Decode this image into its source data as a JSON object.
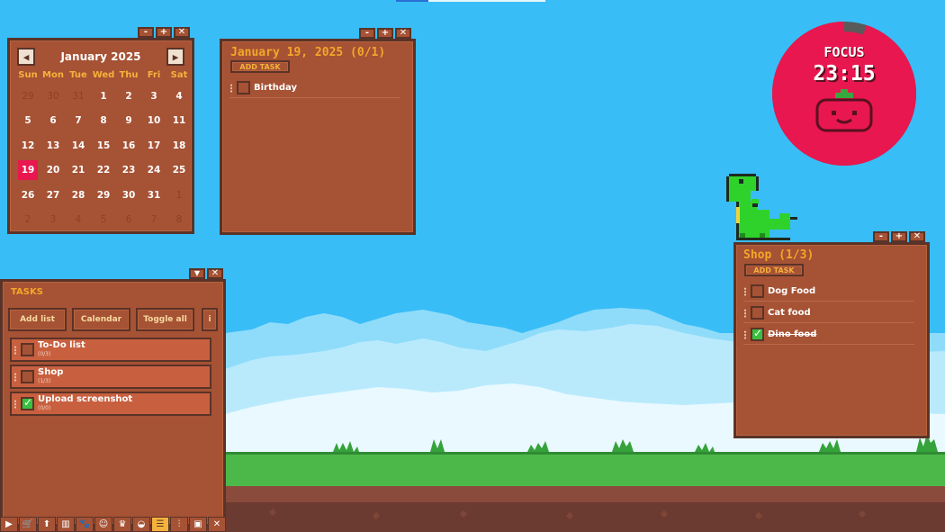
{
  "window_controls": {
    "minimize": "-",
    "maximize": "+",
    "close": "✕"
  },
  "calendar": {
    "prev_icon": "◀",
    "next_icon": "▶",
    "title": "January 2025",
    "weekdays": [
      "Sun",
      "Mon",
      "Tue",
      "Wed",
      "Thu",
      "Fri",
      "Sat"
    ],
    "days": [
      {
        "d": "29",
        "muted": true
      },
      {
        "d": "30",
        "muted": true
      },
      {
        "d": "31",
        "muted": true
      },
      {
        "d": "1"
      },
      {
        "d": "2"
      },
      {
        "d": "3"
      },
      {
        "d": "4"
      },
      {
        "d": "5"
      },
      {
        "d": "6"
      },
      {
        "d": "7"
      },
      {
        "d": "8"
      },
      {
        "d": "9"
      },
      {
        "d": "10"
      },
      {
        "d": "11"
      },
      {
        "d": "12"
      },
      {
        "d": "13"
      },
      {
        "d": "14"
      },
      {
        "d": "15"
      },
      {
        "d": "16"
      },
      {
        "d": "17"
      },
      {
        "d": "18"
      },
      {
        "d": "19",
        "today": true
      },
      {
        "d": "20"
      },
      {
        "d": "21"
      },
      {
        "d": "22"
      },
      {
        "d": "23"
      },
      {
        "d": "24"
      },
      {
        "d": "25"
      },
      {
        "d": "26"
      },
      {
        "d": "27"
      },
      {
        "d": "28"
      },
      {
        "d": "29"
      },
      {
        "d": "30"
      },
      {
        "d": "31"
      },
      {
        "d": "1",
        "muted": true
      },
      {
        "d": "2",
        "muted": true
      },
      {
        "d": "3",
        "muted": true
      },
      {
        "d": "4",
        "muted": true
      },
      {
        "d": "5",
        "muted": true
      },
      {
        "d": "6",
        "muted": true
      },
      {
        "d": "7",
        "muted": true
      },
      {
        "d": "8",
        "muted": true
      }
    ],
    "today_color": "#e8174f"
  },
  "dayview": {
    "title": "January 19, 2025 (0/1)",
    "add_task": "ADD TASK",
    "tasks": [
      {
        "label": "Birthday",
        "done": false
      }
    ]
  },
  "pomodoro": {
    "label": "FOCUS",
    "time": "23:15",
    "progress": 0.05,
    "color": "#e8174f"
  },
  "shop": {
    "title": "Shop (1/3)",
    "add_task": "ADD TASK",
    "tasks": [
      {
        "label": "Dog Food",
        "done": false
      },
      {
        "label": "Cat food",
        "done": false
      },
      {
        "label": "Dino food",
        "done": true
      }
    ]
  },
  "tasks_panel": {
    "title": "TASKS",
    "dropdown_icon": "▼",
    "close": "✕",
    "buttons": {
      "add_list": "Add list",
      "calendar": "Calendar",
      "toggle_all": "Toggle all",
      "info": "i"
    },
    "lists": [
      {
        "name": "To-Do list",
        "count": "(0/3)",
        "checked": false
      },
      {
        "name": "Shop",
        "count": "(1/3)",
        "checked": false
      },
      {
        "name": "Upload screenshot",
        "count": "(0/0)",
        "checked": true
      }
    ]
  },
  "taskbar": [
    {
      "icon": "play-icon",
      "glyph": "▶"
    },
    {
      "icon": "cart-icon",
      "glyph": "🛒"
    },
    {
      "icon": "arrow-up-icon",
      "glyph": "⬆"
    },
    {
      "icon": "stats-icon",
      "glyph": "▥"
    },
    {
      "icon": "paw-icon",
      "glyph": "🐾"
    },
    {
      "icon": "face-icon",
      "glyph": "☺"
    },
    {
      "icon": "trophy-icon",
      "glyph": "♛"
    },
    {
      "icon": "bowl-icon",
      "glyph": "◒"
    },
    {
      "icon": "list-icon",
      "glyph": "☰",
      "active": true
    },
    {
      "icon": "sliders-icon",
      "glyph": "⫶"
    },
    {
      "icon": "twitch-icon",
      "glyph": "▣"
    },
    {
      "icon": "close-icon",
      "glyph": "✕"
    }
  ]
}
